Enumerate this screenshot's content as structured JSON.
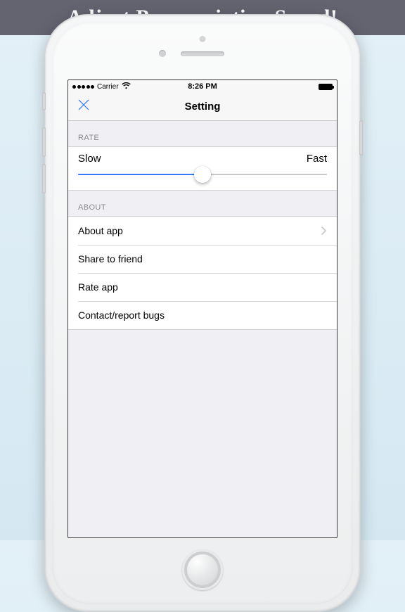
{
  "promo": {
    "headline": "Adjust Pronunciation Speed!"
  },
  "status_bar": {
    "carrier": "Carrier",
    "time": "8:26 PM"
  },
  "nav": {
    "title": "Setting"
  },
  "sections": {
    "rate": {
      "header": "RATE",
      "min_label": "Slow",
      "max_label": "Fast",
      "value_percent": 50
    },
    "about": {
      "header": "ABOUT",
      "items": [
        {
          "label": "About app",
          "disclosure": true
        },
        {
          "label": "Share to friend",
          "disclosure": false
        },
        {
          "label": "Rate app",
          "disclosure": false
        },
        {
          "label": "Contact/report bugs",
          "disclosure": false
        }
      ]
    }
  }
}
